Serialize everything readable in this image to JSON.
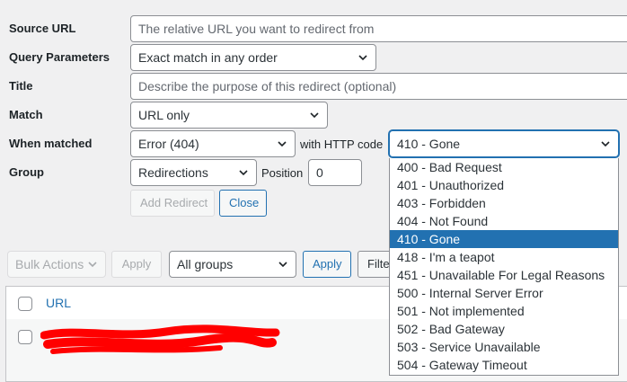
{
  "form": {
    "source_url": {
      "label": "Source URL",
      "placeholder": "The relative URL you want to redirect from"
    },
    "query_parameters": {
      "label": "Query Parameters",
      "value": "Exact match in any order"
    },
    "title": {
      "label": "Title",
      "placeholder": "Describe the purpose of this redirect (optional)"
    },
    "match": {
      "label": "Match",
      "value": "URL only"
    },
    "when_matched": {
      "label": "When matched",
      "value": "Error (404)",
      "http_code_label": "with HTTP code",
      "http_code_value": "410 - Gone"
    },
    "group": {
      "label": "Group",
      "value": "Redirections",
      "position_label": "Position",
      "position_value": "0"
    },
    "add_redirect_label": "Add Redirect",
    "close_label": "Close"
  },
  "http_code_options": [
    "400 - Bad Request",
    "401 - Unauthorized",
    "403 - Forbidden",
    "404 - Not Found",
    "410 - Gone",
    "418 - I'm a teapot",
    "451 - Unavailable For Legal Reasons",
    "500 - Internal Server Error",
    "501 - Not implemented",
    "502 - Bad Gateway",
    "503 - Service Unavailable",
    "504 - Gateway Timeout"
  ],
  "selected_http_code_index": 4,
  "toolbar": {
    "bulk_actions_label": "Bulk Actions",
    "apply_label": "Apply",
    "groups_filter_value": "All groups",
    "apply2_label": "Apply",
    "filter_label": "Filte"
  },
  "table": {
    "url_header": "URL"
  },
  "colors": {
    "accent": "#2271b1",
    "redaction": "#ff0000"
  }
}
